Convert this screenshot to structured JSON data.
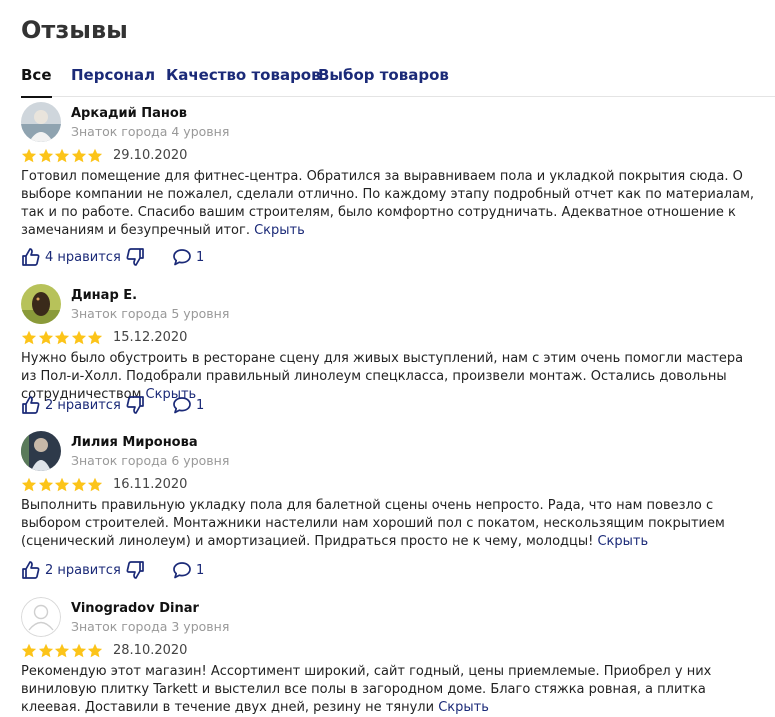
{
  "page": {
    "title": "Отзывы"
  },
  "tabs": [
    {
      "label": "Все",
      "active": true
    },
    {
      "label": "Персонал",
      "active": false
    },
    {
      "label": "Качество товаров",
      "active": false
    },
    {
      "label": "Выбор товаров",
      "active": false
    }
  ],
  "colors": {
    "star": "#fcc419",
    "link": "#1b2a78",
    "muted": "#999999"
  },
  "reviews": [
    {
      "author": "Аркадий Панов",
      "level": "Знаток города 4 уровня",
      "rating": 5,
      "date": "29.10.2020",
      "text": "Готовил помещение для фитнес-центра. Обратился за выравниваем пола и укладкой покрытия сюда. О выборе компании не пожалел, сделали отлично. По каждому этапу подробный отчет как по материалам, так и по работе. Спасибо вашим строителям, было комфортно сотрудничать. Адекватное отношение к замечаниям и безупречный итог.",
      "hide_label": "Скрыть",
      "likes_label": "4 нравится",
      "comments": "1"
    },
    {
      "author": "Динар Е.",
      "level": "Знаток города 5 уровня",
      "rating": 5,
      "date": "15.12.2020",
      "text": "Нужно было обустроить в ресторане сцену для живых выступлений, нам с этим очень помогли мастера из Пол-и-Холл. Подобрали правильный линолеум спецкласса, произвели монтаж. Остались довольны сотрудничеством",
      "hide_label": "Скрыть",
      "likes_label": "2 нравится",
      "comments": "1"
    },
    {
      "author": "Лилия Миронова",
      "level": "Знаток города 6 уровня",
      "rating": 5,
      "date": "16.11.2020",
      "text": "Выполнить правильную укладку пола для балетной сцены очень непросто. Рада, что нам повезло с выбором строителей. Монтажники настелили нам хороший пол с покатом, нескользящим покрытием (сценический линолеум) и амортизацией. Придраться просто не к чему, молодцы!",
      "hide_label": "Скрыть",
      "likes_label": "2 нравится",
      "comments": "1"
    },
    {
      "author": "Vinogradov Dinar",
      "level": "Знаток города 3 уровня",
      "rating": 5,
      "date": "28.10.2020",
      "text": "Рекомендую этот магазин! Ассортимент широкий, сайт годный, цены приемлемые. Приобрел у них виниловую плитку Tarkett и выстелил все полы в загородном доме. Благо стяжка ровная, а плитка клеевая. Доставили в течение двух дней, резину не тянули",
      "hide_label": "Скрыть"
    }
  ]
}
